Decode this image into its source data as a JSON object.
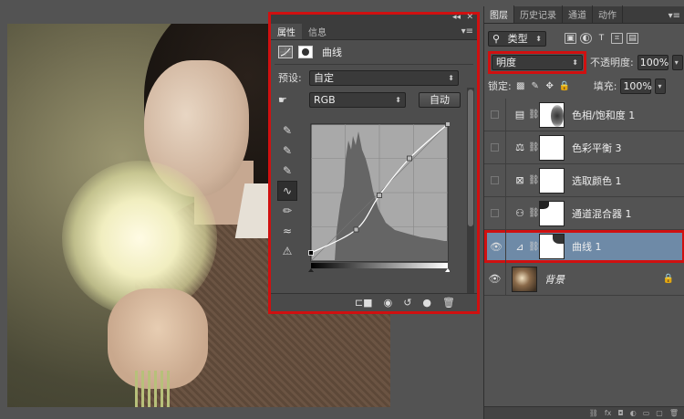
{
  "properties_panel": {
    "collapse_icon": "double-chevron-icon",
    "close_icon": "close-icon",
    "tabs": [
      {
        "label": "属性"
      },
      {
        "label": "信息"
      }
    ],
    "header_title": "曲线",
    "preset_label": "预设:",
    "preset_value": "自定",
    "channel_value": "RGB",
    "auto_label": "自动",
    "tools": [
      "hand-adjust-icon",
      "black-point-eyedropper-icon",
      "gray-point-eyedropper-icon",
      "white-point-eyedropper-icon",
      "curve-edit-icon",
      "pencil-icon",
      "smooth-icon",
      "warning-icon"
    ],
    "curve_points": [
      [
        0,
        0.06
      ],
      [
        0.33,
        0.23
      ],
      [
        0.5,
        0.48
      ],
      [
        0.72,
        0.75
      ],
      [
        1,
        1
      ]
    ],
    "footer_icons": [
      "clip-to-layer-icon",
      "view-previous-icon",
      "reset-icon",
      "visibility-icon",
      "trash-icon"
    ]
  },
  "layers_panel": {
    "tabs": [
      {
        "label": "图层",
        "active": true
      },
      {
        "label": "历史记录",
        "active": false
      },
      {
        "label": "通道",
        "active": false
      },
      {
        "label": "动作",
        "active": false
      }
    ],
    "filter_label": "类型",
    "blend_mode": "明度",
    "opacity_label": "不透明度:",
    "opacity_value": "100%",
    "lock_label": "锁定:",
    "fill_label": "填充:",
    "fill_value": "100%",
    "layers": [
      {
        "name": "色相/饱和度 1",
        "icon": "hue-saturation-icon",
        "visible": false,
        "selected": false
      },
      {
        "name": "色彩平衡 3",
        "icon": "color-balance-icon",
        "visible": false,
        "selected": false
      },
      {
        "name": "选取颜色 1",
        "icon": "selective-color-icon",
        "visible": false,
        "selected": false
      },
      {
        "name": "通道混合器 1",
        "icon": "channel-mixer-icon",
        "visible": false,
        "selected": false
      },
      {
        "name": "曲线 1",
        "icon": "curves-icon",
        "visible": true,
        "selected": true
      },
      {
        "name": "背景",
        "icon": "",
        "visible": true,
        "selected": false
      }
    ]
  }
}
